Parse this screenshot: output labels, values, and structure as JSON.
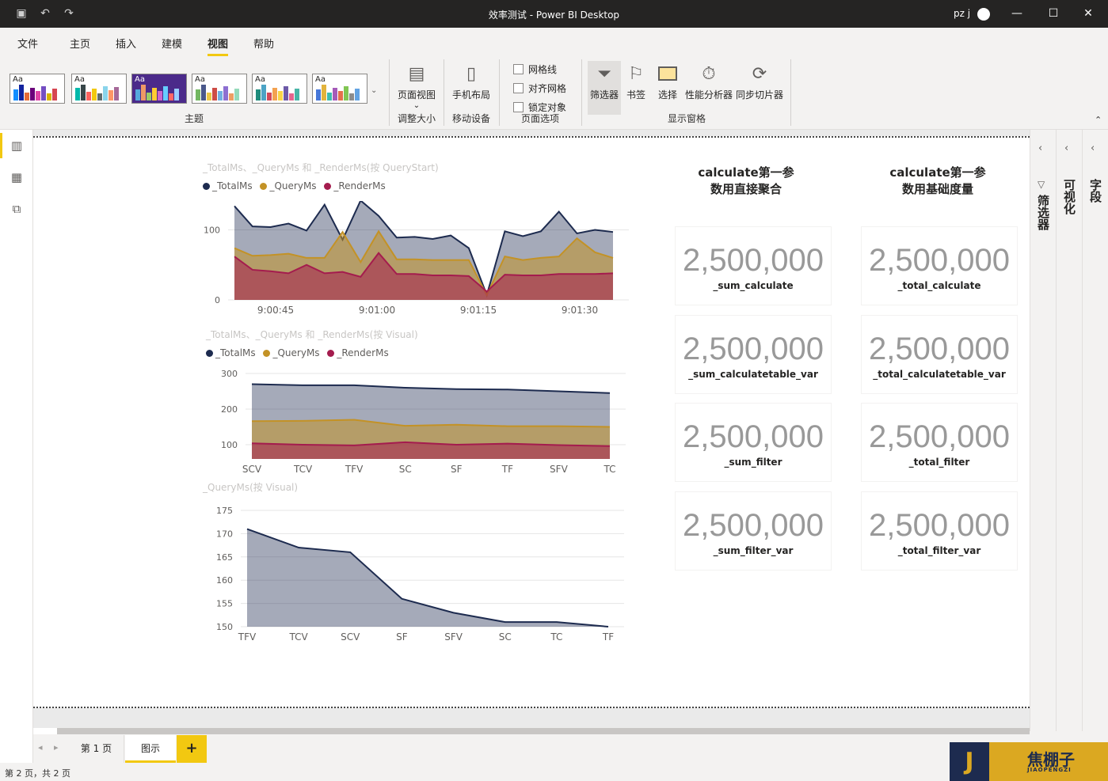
{
  "window": {
    "title": "效率测试 - Power BI Desktop",
    "user": "pz j"
  },
  "menu": [
    "文件",
    "主页",
    "插入",
    "建模",
    "视图",
    "帮助"
  ],
  "ribbon": {
    "groups": {
      "theme": "主题",
      "resize": "调整大小",
      "mobile": "移动设备",
      "page_options": "页面选项",
      "show_panes": "显示窗格"
    },
    "page_view": "页面视图",
    "phone_layout": "手机布局",
    "checks": [
      "网格线",
      "对齐网格",
      "锁定对象"
    ],
    "panes": [
      "筛选器",
      "书签",
      "选择",
      "性能分析器",
      "同步切片器"
    ],
    "theme_aa": "Aa"
  },
  "colors": {
    "total": "#1d2b4f",
    "query": "#c39226",
    "render": "#a41c4e"
  },
  "chart_data": [
    {
      "type": "area",
      "title": "_TotalMs、_QueryMs 和 _RenderMs(按 QueryStart)",
      "x_ticks": [
        "9:00:45",
        "9:01:00",
        "9:01:15",
        "9:01:30"
      ],
      "y_ticks": [
        "0",
        "100"
      ],
      "ylim": [
        0,
        130
      ],
      "series": [
        {
          "name": "_TotalMs",
          "values": [
            134,
            105,
            104,
            109,
            99,
            136,
            86,
            142,
            120,
            89,
            90,
            87,
            92,
            74,
            7,
            98,
            91,
            98,
            126,
            95,
            100,
            97
          ]
        },
        {
          "name": "_QueryMs",
          "values": [
            74,
            63,
            64,
            66,
            60,
            60,
            97,
            54,
            98,
            58,
            58,
            57,
            57,
            57,
            7,
            62,
            57,
            60,
            62,
            88,
            68,
            60
          ]
        },
        {
          "name": "_RenderMs",
          "values": [
            62,
            43,
            41,
            38,
            50,
            38,
            40,
            33,
            67,
            37,
            37,
            35,
            35,
            34,
            12,
            36,
            35,
            35,
            37,
            37,
            37,
            38
          ]
        }
      ]
    },
    {
      "type": "area",
      "title": "_TotalMs、_QueryMs 和 _RenderMs(按 Visual)",
      "categories": [
        "SCV",
        "TCV",
        "TFV",
        "SC",
        "SF",
        "TF",
        "SFV",
        "TC"
      ],
      "y_ticks": [
        "100",
        "200",
        "300"
      ],
      "ylim": [
        60,
        300
      ],
      "series": [
        {
          "name": "_TotalMs",
          "values": [
            270,
            267,
            267,
            260,
            256,
            255,
            250,
            245
          ]
        },
        {
          "name": "_QueryMs",
          "values": [
            166,
            167,
            170,
            153,
            156,
            152,
            152,
            150
          ]
        },
        {
          "name": "_RenderMs",
          "values": [
            104,
            100,
            98,
            107,
            100,
            103,
            99,
            96
          ]
        }
      ]
    },
    {
      "type": "area",
      "title": "_QueryMs(按 Visual)",
      "categories": [
        "TFV",
        "TCV",
        "SCV",
        "SF",
        "SFV",
        "SC",
        "TC",
        "TF"
      ],
      "y_ticks": [
        "150",
        "155",
        "160",
        "165",
        "170",
        "175"
      ],
      "ylim": [
        150,
        175
      ],
      "series": [
        {
          "name": "_QueryMs",
          "values": [
            171,
            167,
            166,
            156,
            153,
            151,
            151,
            150
          ]
        }
      ]
    }
  ],
  "headers": [
    "calculate第一参\n数用直接聚合",
    "calculate第一参\n数用基础度量"
  ],
  "cards": [
    {
      "value": "2,500,000",
      "label": "_sum_calculate"
    },
    {
      "value": "2,500,000",
      "label": "_total_calculate"
    },
    {
      "value": "2,500,000",
      "label": "_sum_calculatetable_var"
    },
    {
      "value": "2,500,000",
      "label": "_total_calculatetable_var"
    },
    {
      "value": "2,500,000",
      "label": "_sum_filter"
    },
    {
      "value": "2,500,000",
      "label": "_total_filter"
    },
    {
      "value": "2,500,000",
      "label": "_sum_filter_var"
    },
    {
      "value": "2,500,000",
      "label": "_total_filter_var"
    }
  ],
  "right_panes": [
    "筛选器",
    "可视化",
    "字段"
  ],
  "tabs": [
    "第 1 页",
    "图示",
    "+"
  ],
  "status": "第 2 页，共 2 页",
  "logo": {
    "letter": "J",
    "name": "焦棚子",
    "pinyin": "JIAOPENGZI"
  }
}
